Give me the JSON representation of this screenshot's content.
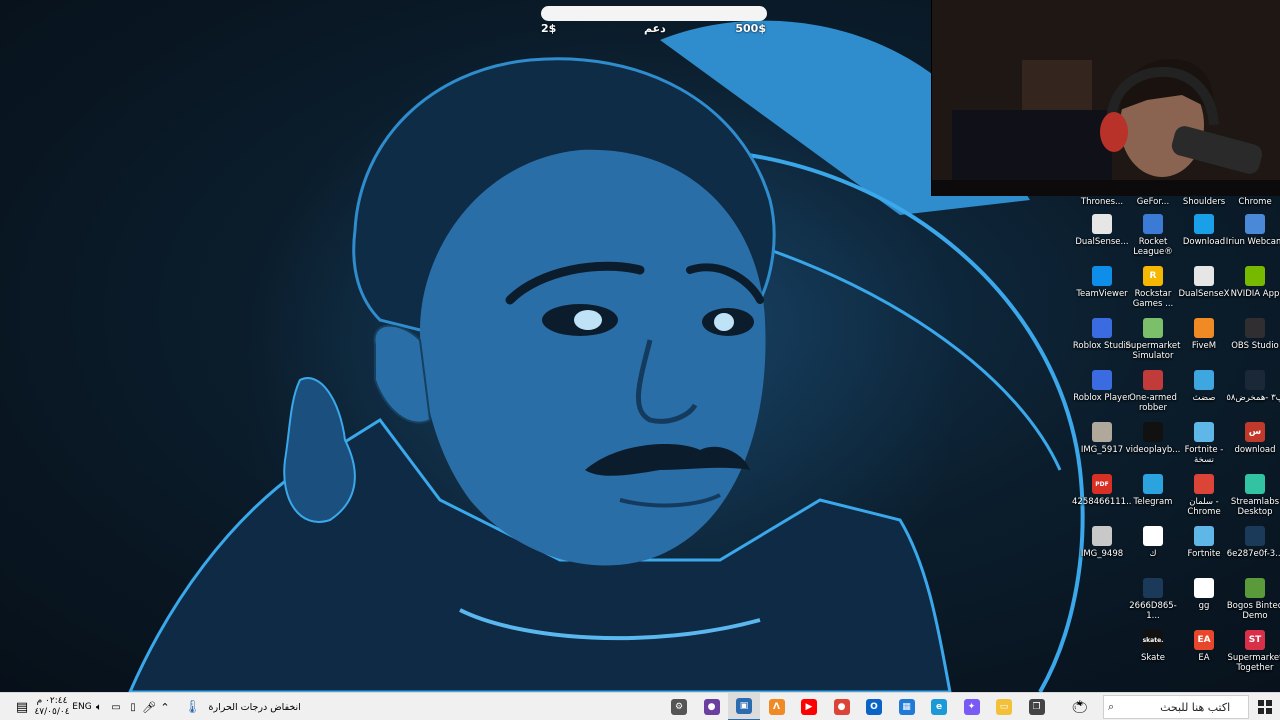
{
  "donation_goal": {
    "min_label": "2$",
    "title": "دعم",
    "max_label": "500$",
    "progress_fraction": 0.0
  },
  "desktop_icons": [
    {
      "label": "Thrones...",
      "color": "#6b6b6b",
      "glyph": "",
      "name": "desktop-icon-thrones"
    },
    {
      "label": "GeFor...",
      "color": "#76b900",
      "glyph": "",
      "name": "desktop-icon-geforce"
    },
    {
      "label": "Shoulders",
      "color": "#8a6a4a",
      "glyph": "",
      "name": "desktop-icon-shoulders"
    },
    {
      "label": "Chrome",
      "color": "#db4437",
      "glyph": "",
      "name": "desktop-icon-chrome-top"
    },
    {
      "label": "DualSense...",
      "color": "#e6e6e6",
      "glyph": "",
      "name": "desktop-icon-dualsense"
    },
    {
      "label": "Rocket League®",
      "color": "#3b7bd6",
      "glyph": "",
      "name": "desktop-icon-rocket-league"
    },
    {
      "label": "Download",
      "color": "#1aa0e8",
      "glyph": "",
      "name": "desktop-icon-download-edge"
    },
    {
      "label": "Iriun Webcam",
      "color": "#4a88d8",
      "glyph": "",
      "name": "desktop-icon-iriun-webcam"
    },
    {
      "label": "TeamViewer",
      "color": "#0e8ee9",
      "glyph": "",
      "name": "desktop-icon-teamviewer"
    },
    {
      "label": "Rockstar Games ...",
      "color": "#f5b700",
      "glyph": "R",
      "name": "desktop-icon-rockstar"
    },
    {
      "label": "DualSenseX",
      "color": "#e6e6e6",
      "glyph": "",
      "name": "desktop-icon-dualsensex"
    },
    {
      "label": "NVIDIA App",
      "color": "#76b900",
      "glyph": "",
      "name": "desktop-icon-nvidia-app"
    },
    {
      "label": "Roblox Studio",
      "color": "#3b6be0",
      "glyph": "",
      "name": "desktop-icon-roblox-studio"
    },
    {
      "label": "Supermarket Simulator",
      "color": "#7bbf6a",
      "glyph": "",
      "name": "desktop-icon-supermarket-simulator"
    },
    {
      "label": "FiveM",
      "color": "#f08a24",
      "glyph": "",
      "name": "desktop-icon-fivem"
    },
    {
      "label": "OBS Studio",
      "color": "#302e31",
      "glyph": "",
      "name": "desktop-icon-obs-studio"
    },
    {
      "label": "Roblox Player",
      "color": "#3b6be0",
      "glyph": "",
      "name": "desktop-icon-roblox-player"
    },
    {
      "label": "One-armed robber",
      "color": "#c23b3b",
      "glyph": "",
      "name": "desktop-icon-one-armed-robber"
    },
    {
      "label": "صضث",
      "color": "#3fa7e0",
      "glyph": "",
      "name": "desktop-icon-arabic-1"
    },
    {
      "label": "پ٣ -همخرض٥٨",
      "color": "#1b2838",
      "glyph": "",
      "name": "desktop-icon-steam"
    },
    {
      "label": "IMG_5917",
      "color": "#b0a89a",
      "glyph": "",
      "name": "desktop-icon-img-5917"
    },
    {
      "label": "videoplayb...",
      "color": "#111111",
      "glyph": "",
      "name": "desktop-icon-videoplayback"
    },
    {
      "label": "Fortnite - نسخة",
      "color": "#5fb7e8",
      "glyph": "",
      "name": "desktop-icon-fortnite-copy"
    },
    {
      "label": "download",
      "color": "#c0392b",
      "glyph": "س",
      "name": "desktop-icon-download"
    },
    {
      "label": "4258466111...",
      "color": "#d93025",
      "glyph": "PDF",
      "name": "desktop-icon-pdf"
    },
    {
      "label": "Telegram",
      "color": "#2aa3df",
      "glyph": "",
      "name": "desktop-icon-telegram"
    },
    {
      "label": "سلمان - Chrome",
      "color": "#db4437",
      "glyph": "",
      "name": "desktop-icon-chrome-salman"
    },
    {
      "label": "Streamlabs Desktop",
      "color": "#31c3a2",
      "glyph": "",
      "name": "desktop-icon-streamlabs"
    },
    {
      "label": "IMG_9498",
      "color": "#c8c8c8",
      "glyph": "",
      "name": "desktop-icon-img-9498"
    },
    {
      "label": "ك",
      "color": "#ffffff",
      "glyph": "",
      "name": "desktop-icon-kaf"
    },
    {
      "label": "Fortnite",
      "color": "#5fb7e8",
      "glyph": "",
      "name": "desktop-icon-fortnite"
    },
    {
      "label": "6e287e0f-3...",
      "color": "#1b3a5a",
      "glyph": "",
      "name": "desktop-icon-6e287e0f"
    },
    {
      "label": "2666D865-1...",
      "color": "#1b3a5a",
      "glyph": "",
      "name": "desktop-icon-2666d865"
    },
    {
      "label": "gg",
      "color": "#ffffff",
      "glyph": "",
      "name": "desktop-icon-gg"
    },
    {
      "label": "Bogos Binted Demo",
      "color": "#5a9a3a",
      "glyph": "",
      "name": "desktop-icon-bogos-binted"
    },
    {
      "label": "Skate",
      "color": "#111111",
      "glyph": "skate.",
      "name": "desktop-icon-skate"
    },
    {
      "label": "EA",
      "color": "#e8472b",
      "glyph": "EA",
      "name": "desktop-icon-ea"
    },
    {
      "label": "Supermarket Together",
      "color": "#d9304a",
      "glyph": "ST",
      "name": "desktop-icon-supermarket-together"
    }
  ],
  "taskbar": {
    "search_placeholder": "اكتب هنا للبحث",
    "weather_text": "انخفاض درجات الحرارة",
    "language": "ENG",
    "time": "٠٢:٤٤ م",
    "date": "٤٧/٠٥/٠٤",
    "pinned_apps": [
      {
        "name": "tb-settings",
        "icon": "gear-icon",
        "color": "#555555",
        "glyph": "⚙"
      },
      {
        "name": "tb-obs",
        "icon": "obs-icon",
        "color": "#6b3fa0",
        "glyph": "●"
      },
      {
        "name": "tb-active-window",
        "icon": "window-icon",
        "color": "#2b6cb0",
        "glyph": "▣"
      },
      {
        "name": "tb-fivem",
        "icon": "fivem-icon",
        "color": "#f08a24",
        "glyph": "Λ"
      },
      {
        "name": "tb-youtube",
        "icon": "youtube-icon",
        "color": "#ff0000",
        "glyph": "▶"
      },
      {
        "name": "tb-chrome",
        "icon": "chrome-icon",
        "color": "#db4437",
        "glyph": "●"
      },
      {
        "name": "tb-outlook",
        "icon": "outlook-icon",
        "color": "#0a64c8",
        "glyph": "O"
      },
      {
        "name": "tb-store",
        "icon": "store-icon",
        "color": "#1f7ad8",
        "glyph": "▦"
      },
      {
        "name": "tb-edge",
        "icon": "edge-icon",
        "color": "#1a9bd7",
        "glyph": "e"
      },
      {
        "name": "tb-copilot",
        "icon": "copilot-icon",
        "color": "#7a5af5",
        "glyph": "✦"
      },
      {
        "name": "tb-file-explorer",
        "icon": "folder-icon",
        "color": "#f3c03a",
        "glyph": "▭"
      },
      {
        "name": "tb-task-view",
        "icon": "task-view-icon",
        "color": "#444444",
        "glyph": "❐"
      }
    ]
  }
}
